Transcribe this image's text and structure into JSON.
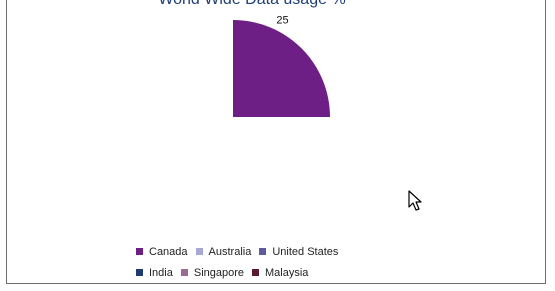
{
  "chart_data": {
    "type": "pie",
    "title": "World Wide Data usage %",
    "categories": [
      "Canada",
      "Australia",
      "United States",
      "India",
      "Singapore",
      "Malaysia"
    ],
    "values": [
      25,
      null,
      null,
      null,
      null,
      null
    ],
    "data_labels": [
      "25"
    ],
    "colors": [
      "#6e1f86",
      "#a6a9d1",
      "#5c5b9e",
      "#1e3a6e",
      "#9a6b95",
      "#5a1a2e"
    ],
    "legend_placement": "bottom"
  }
}
